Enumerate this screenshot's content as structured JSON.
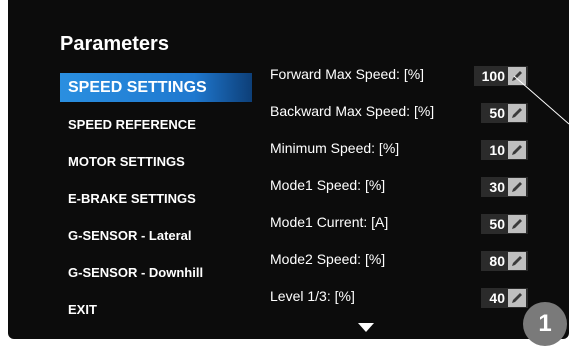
{
  "title": "Parameters",
  "menu": [
    {
      "label": "SPEED SETTINGS",
      "active": true
    },
    {
      "label": "SPEED REFERENCE",
      "active": false
    },
    {
      "label": "MOTOR SETTINGS",
      "active": false
    },
    {
      "label": "E-BRAKE SETTINGS",
      "active": false
    },
    {
      "label": "G-SENSOR - Lateral",
      "active": false
    },
    {
      "label": "G-SENSOR - Downhill",
      "active": false
    },
    {
      "label": "EXIT",
      "active": false
    }
  ],
  "params": [
    {
      "label": "Forward Max Speed: [%]",
      "value": "100"
    },
    {
      "label": "Backward Max Speed: [%]",
      "value": "50"
    },
    {
      "label": "Minimum Speed: [%]",
      "value": "10"
    },
    {
      "label": "Mode1 Speed: [%]",
      "value": "30"
    },
    {
      "label": "Mode1 Current: [A]",
      "value": "50"
    },
    {
      "label": "Mode2 Speed: [%]",
      "value": "80"
    },
    {
      "label": "Level 1/3: [%]",
      "value": "40"
    }
  ],
  "callout_badge": "1",
  "icons": {
    "edit": "pencil-icon",
    "scroll_down": "triangle-down-icon"
  },
  "colors": {
    "screen_bg": "#0c0c0c",
    "active_menu": "#2a8fe0",
    "value_box": "#2b2b2b",
    "badge": "#7a7a7a"
  }
}
